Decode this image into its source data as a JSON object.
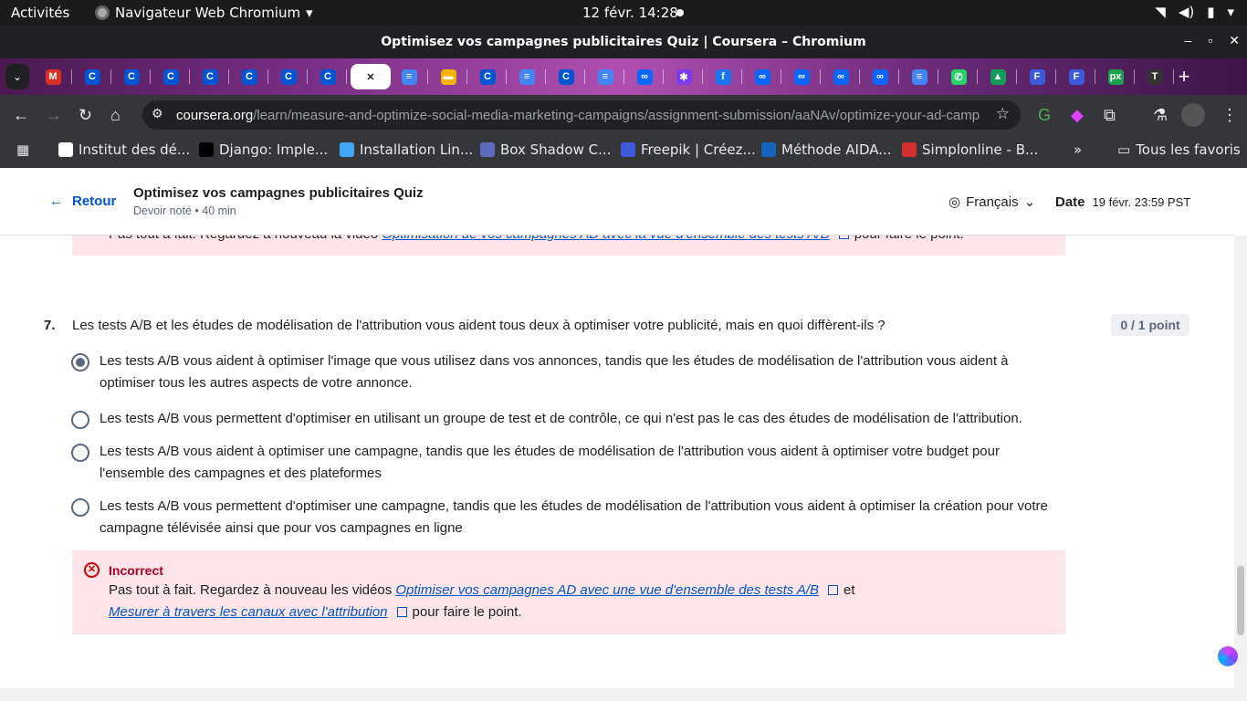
{
  "os": {
    "activities": "Activités",
    "app": "Navigateur Web Chromium",
    "clock": "12 févr.  14:28"
  },
  "window": {
    "title": "Optimisez vos campagnes publicitaires Quiz | Coursera – Chromium"
  },
  "tabs": [
    {
      "icon": "M",
      "color": "#d93025"
    },
    {
      "icon": "C",
      "color": "#0056d2"
    },
    {
      "icon": "C",
      "color": "#0056d2"
    },
    {
      "icon": "C",
      "color": "#0056d2"
    },
    {
      "icon": "C",
      "color": "#0056d2"
    },
    {
      "icon": "C",
      "color": "#0056d2"
    },
    {
      "icon": "C",
      "color": "#0056d2"
    },
    {
      "icon": "C",
      "color": "#0056d2"
    },
    {
      "icon": "✕",
      "color": "#202124",
      "active": true
    },
    {
      "icon": "≡",
      "color": "#4285f4"
    },
    {
      "icon": "▬",
      "color": "#f4b400"
    },
    {
      "icon": "C",
      "color": "#0056d2"
    },
    {
      "icon": "≡",
      "color": "#4285f4"
    },
    {
      "icon": "C",
      "color": "#0056d2"
    },
    {
      "icon": "≡",
      "color": "#4285f4"
    },
    {
      "icon": "∞",
      "color": "#0866ff"
    },
    {
      "icon": "✱",
      "color": "#7c3aed"
    },
    {
      "icon": "f",
      "color": "#1877f2"
    },
    {
      "icon": "∞",
      "color": "#0866ff"
    },
    {
      "icon": "∞",
      "color": "#0866ff"
    },
    {
      "icon": "∞",
      "color": "#0866ff"
    },
    {
      "icon": "∞",
      "color": "#0866ff"
    },
    {
      "icon": "≡",
      "color": "#4285f4"
    },
    {
      "icon": "✆",
      "color": "#25d366"
    },
    {
      "icon": "▲",
      "color": "#0f9d58"
    },
    {
      "icon": "F",
      "color": "#3b5bdb"
    },
    {
      "icon": "F",
      "color": "#3b5bdb"
    },
    {
      "icon": "px",
      "color": "#1aa34a"
    },
    {
      "icon": "T",
      "color": "#333"
    }
  ],
  "toolbar": {
    "url_host": "coursera.org",
    "url_path": "/learn/measure-and-optimize-social-media-marketing-campaigns/assignment-submission/aaNAv/optimize-your-ad-campaigns-..."
  },
  "bookmarks": [
    "Institut des dé...",
    "Django: Imple...",
    "Installation Lin...",
    "Box Shadow C...",
    "Freepik | Créez...",
    "Méthode AIDA...",
    "Simplonline - B..."
  ],
  "bookmarks_all": "Tous les favoris",
  "header": {
    "back": "Retour",
    "title": "Optimisez vos campagnes publicitaires Quiz",
    "subtitle": "Devoir noté • 40 min",
    "language": "Français",
    "due_label": "Date",
    "due_value": "19 févr. 23:59 PST"
  },
  "prev_feedback": {
    "text": "Pas tout à fait. Regardez à nouveau la vidéo ",
    "link": "Optimisation de vos campagnes AD avec la vue d'ensemble des tests A/B",
    "after": "pour faire le point."
  },
  "question": {
    "number": "7.",
    "text": "Les tests A/B et les études de modélisation de l'attribution vous aident tous deux à optimiser votre publicité, mais en quoi diffèrent-ils ?",
    "points": "0 / 1 point",
    "options": [
      {
        "text": "Les tests A/B vous aident à optimiser l'image que vous utilisez dans vos annonces, tandis que les études de modélisation de l'attribution vous aident à optimiser tous les autres aspects de votre annonce.",
        "selected": true
      },
      {
        "text": "Les tests A/B vous permettent d'optimiser en utilisant un groupe de test et de contrôle, ce qui n'est pas le cas des études de modélisation de l'attribution.",
        "selected": false
      },
      {
        "text": "Les tests A/B vous aident à optimiser une campagne, tandis que les études de modélisation de l'attribution vous aident à optimiser votre budget pour l'ensemble des campagnes et des plateformes",
        "selected": false
      },
      {
        "text": "Les tests A/B vous permettent d'optimiser une campagne, tandis que les études de modélisation de l'attribution vous aident à optimiser la création pour votre campagne télévisée ainsi que pour vos campagnes en ligne",
        "selected": false
      }
    ]
  },
  "feedback": {
    "label": "Incorrect",
    "l1_pre": "Pas tout à fait. Regardez à nouveau les vidéos ",
    "link1": "Optimiser vos campagnes AD avec une vue d'ensemble des tests A/B",
    "l1_post": "et",
    "link2": "Mesurer à travers les canaux avec l'attribution",
    "l2_post": "pour faire le point."
  }
}
